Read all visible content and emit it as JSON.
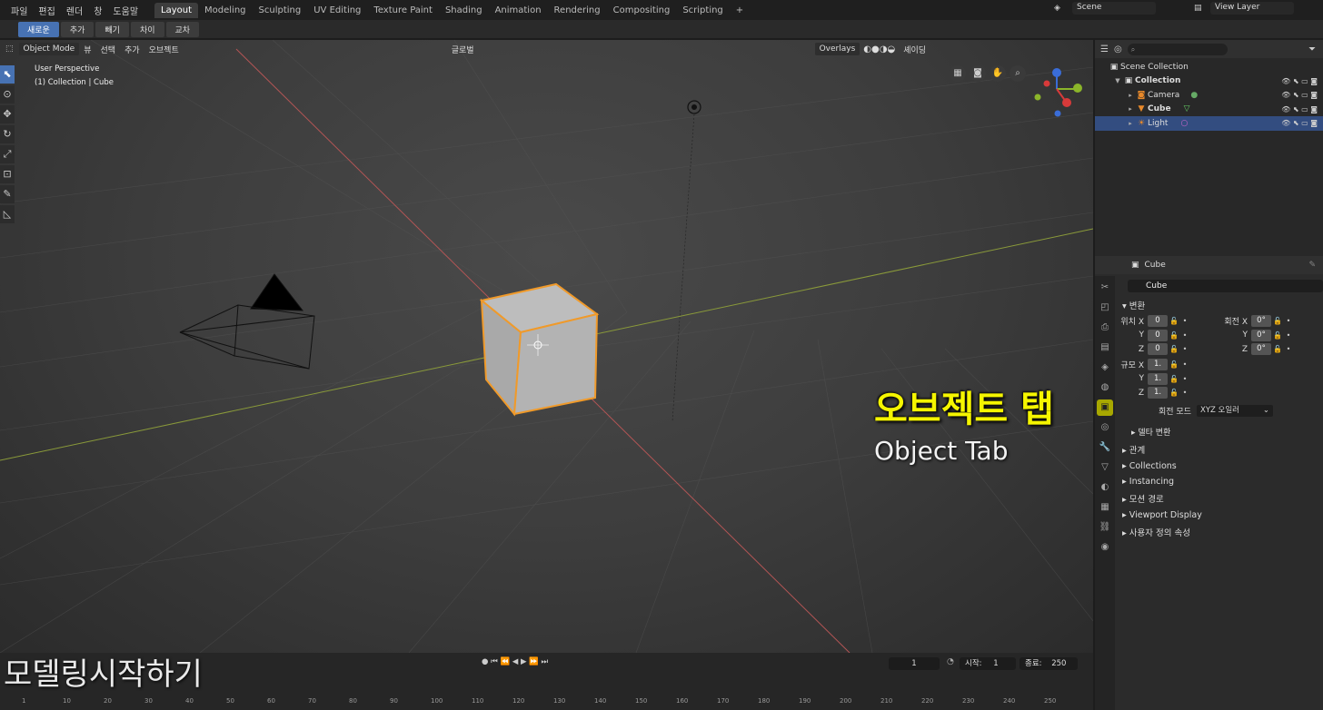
{
  "menu": [
    "파일",
    "편집",
    "렌더",
    "창",
    "도움말"
  ],
  "workspaces": [
    "Layout",
    "Modeling",
    "Sculpting",
    "UV Editing",
    "Texture Paint",
    "Shading",
    "Animation",
    "Rendering",
    "Compositing",
    "Scripting",
    "+"
  ],
  "scene": {
    "label": "Scene",
    "view_layer": "View Layer"
  },
  "tool_modes": [
    "새로운",
    "추가",
    "빼기",
    "차이",
    "교차"
  ],
  "viewport_header": {
    "mode": "Object Mode",
    "view": "뷰",
    "select": "선택",
    "add": "추가",
    "object": "오브젝트",
    "transform": "글로벌",
    "overlays": "Overlays",
    "shading": "셰이딩"
  },
  "viewport_info": {
    "perspective": "User Perspective",
    "collection": "(1) Collection | Cube"
  },
  "overlay": {
    "title": "오브젝트 탭",
    "subtitle": "Object Tab"
  },
  "watermark": "모델링시작하기",
  "outliner": {
    "search_placeholder": "",
    "rows": [
      {
        "label": "Scene Collection",
        "icon": "scene-collection-icon"
      },
      {
        "label": "Collection",
        "icon": "collection-icon"
      },
      {
        "label": "Camera",
        "icon": "camera-icon"
      },
      {
        "label": "Cube",
        "icon": "mesh-icon"
      },
      {
        "label": "Light",
        "icon": "light-icon"
      }
    ]
  },
  "properties": {
    "header_object": "Cube",
    "object_name": "Cube",
    "transform_section": "변환",
    "location_label": "위치 X",
    "rotation_label": "회전 X",
    "scale_label": "규모 X",
    "axis_y": "Y",
    "axis_z": "Z",
    "loc": [
      "0",
      "0",
      "0"
    ],
    "rot": [
      "0°",
      "0°",
      "0°"
    ],
    "scale": [
      "1.",
      "1.",
      "1."
    ],
    "rotation_mode_label": "회전 모드",
    "rotation_mode_value": "XYZ 오일러",
    "delta_section": "델타 변환",
    "sections": [
      "관계",
      "Collections",
      "Instancing",
      "모션 경로",
      "Viewport Display",
      "사용자 정의 속성"
    ]
  },
  "timeline": {
    "current_frame": "1",
    "start_label": "시작:",
    "start": "1",
    "end_label": "종료:",
    "end": "250"
  },
  "ruler_ticks": [
    "1",
    "10",
    "20",
    "30",
    "40",
    "50",
    "60",
    "70",
    "80",
    "90",
    "100",
    "110",
    "120",
    "130",
    "140",
    "150",
    "160",
    "170",
    "180",
    "190",
    "200",
    "210",
    "220",
    "230",
    "240",
    "250"
  ]
}
